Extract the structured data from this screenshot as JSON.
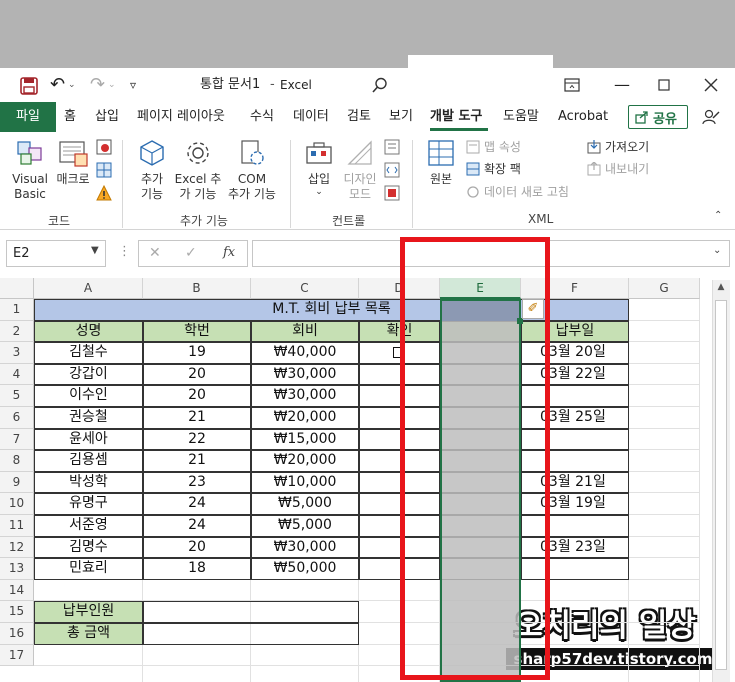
{
  "window": {
    "title": "통합 문서1",
    "app": "Excel"
  },
  "ribbon_tabs": [
    "파일",
    "홈",
    "삽입",
    "페이지 레이아웃",
    "수식",
    "데이터",
    "검토",
    "보기",
    "개발 도구",
    "도움말",
    "Acrobat"
  ],
  "active_tab": "개발 도구",
  "share_label": "공유",
  "ribbon": {
    "code": {
      "visual_basic_1": "Visual",
      "visual_basic_2": "Basic",
      "macro": "매크로",
      "label": "코드"
    },
    "addins": {
      "add_1": "추가",
      "add_2": "기능",
      "excel_add_1": "Excel 추",
      "excel_add_2": "가 기능",
      "com_1": "COM",
      "com_2": "추가 기능",
      "label": "추가 기능"
    },
    "controls": {
      "insert": "삽입",
      "design_1": "디자인",
      "design_2": "모드",
      "label": "컨트롤"
    },
    "xml": {
      "source": "원본",
      "map_props": "맵 속성",
      "expansion": "확장 팩",
      "refresh": "데이터 새로 고침",
      "import": "가져오기",
      "export": "내보내기",
      "label": "XML"
    }
  },
  "formula_bar": {
    "name_box": "E2",
    "fx": "fx",
    "content": ""
  },
  "columns": [
    "A",
    "B",
    "C",
    "D",
    "E",
    "F",
    "G"
  ],
  "rows": [
    "1",
    "2",
    "3",
    "4",
    "5",
    "6",
    "7",
    "8",
    "9",
    "10",
    "11",
    "12",
    "13",
    "14",
    "15",
    "16",
    "17"
  ],
  "sheet": {
    "title": "M.T. 회비 납부 목록",
    "headers": [
      "성명",
      "학번",
      "회비",
      "확인",
      "",
      "납부일"
    ],
    "records": [
      {
        "name": "김철수",
        "id": "19",
        "fee": "₩40,000",
        "date": "03월 20일"
      },
      {
        "name": "강갑이",
        "id": "20",
        "fee": "₩30,000",
        "date": "03월 22일"
      },
      {
        "name": "이수인",
        "id": "20",
        "fee": "₩30,000",
        "date": ""
      },
      {
        "name": "권승철",
        "id": "21",
        "fee": "₩20,000",
        "date": "03월 25일"
      },
      {
        "name": "윤세아",
        "id": "22",
        "fee": "₩15,000",
        "date": ""
      },
      {
        "name": "김용셈",
        "id": "21",
        "fee": "₩20,000",
        "date": ""
      },
      {
        "name": "박성학",
        "id": "23",
        "fee": "₩10,000",
        "date": "03월 21일"
      },
      {
        "name": "유명구",
        "id": "24",
        "fee": "₩5,000",
        "date": "03월 19일"
      },
      {
        "name": "서준영",
        "id": "24",
        "fee": "₩5,000",
        "date": ""
      },
      {
        "name": "김명수",
        "id": "20",
        "fee": "₩30,000",
        "date": "03월 23일"
      },
      {
        "name": "민효리",
        "id": "18",
        "fee": "₩50,000",
        "date": ""
      }
    ],
    "summary": [
      "납부인원",
      "총 금액"
    ]
  },
  "watermark": {
    "line1": "오치리의 일상",
    "line2": "sharp57dev.tistory.com"
  },
  "colors": {
    "excel_green": "#217346",
    "header_green": "#c6e0b4",
    "title_blue": "#b4c6e7",
    "highlight_red": "#e8151b"
  }
}
